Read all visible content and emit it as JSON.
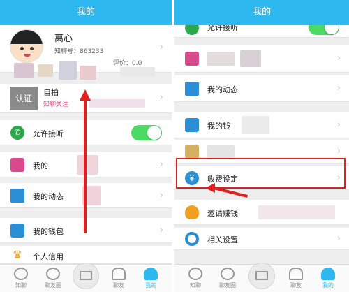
{
  "left": {
    "header_title": "我的",
    "profile": {
      "name": "离心",
      "id_text": "知聊号：863233",
      "rating_text": "评价：0.0"
    },
    "verify": {
      "badge": "认证",
      "title": "自拍",
      "subtitle": "知聊关注"
    },
    "items": {
      "allow_answer": "允许接听",
      "partial_item": "我的",
      "my_posts": "我的动态",
      "my_wallet": "我的钱包",
      "personal_credit": "个人信用"
    },
    "tabs": [
      "知聊",
      "聊友圈",
      "聊友",
      "我的"
    ]
  },
  "right": {
    "header_title": "我的",
    "items": {
      "allow_answer": "允许接听",
      "my_posts": "我的动态",
      "my_wallet": "我的钱",
      "fee_settings": "收费设定",
      "invite": "邀请赚钱",
      "settings": "相关设置"
    },
    "tabs": [
      "知聊",
      "聊友圈",
      "聊友",
      "我的"
    ]
  },
  "toggle_state": "on",
  "colors": {
    "header": "#2eb8f0",
    "toggle_on": "#4cd964",
    "highlight": "#e02020",
    "tab_active": "#2eb8f0"
  }
}
